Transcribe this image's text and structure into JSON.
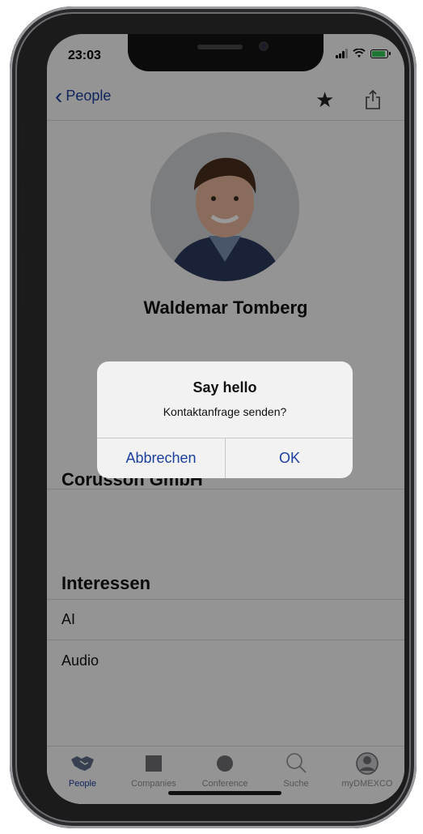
{
  "status": {
    "time": "23:03"
  },
  "nav": {
    "back_label": "People"
  },
  "profile": {
    "name": "Waldemar Tomberg",
    "company": "Corusson GmbH"
  },
  "interests": {
    "title": "Interessen",
    "items": [
      "AI",
      "Audio"
    ]
  },
  "alert": {
    "title": "Say hello",
    "message": "Kontaktanfrage senden?",
    "cancel_label": "Abbrechen",
    "ok_label": "OK"
  },
  "tabs": [
    {
      "label": "People",
      "icon": "handshake-icon",
      "active": true
    },
    {
      "label": "Companies",
      "icon": "square-icon",
      "active": false
    },
    {
      "label": "Conference",
      "icon": "circle-icon",
      "active": false
    },
    {
      "label": "Suche",
      "icon": "search-icon",
      "active": false
    },
    {
      "label": "myDMEXCO",
      "icon": "user-icon",
      "active": false
    }
  ],
  "colors": {
    "accent": "#1b3f9c",
    "battery": "#34c759"
  }
}
